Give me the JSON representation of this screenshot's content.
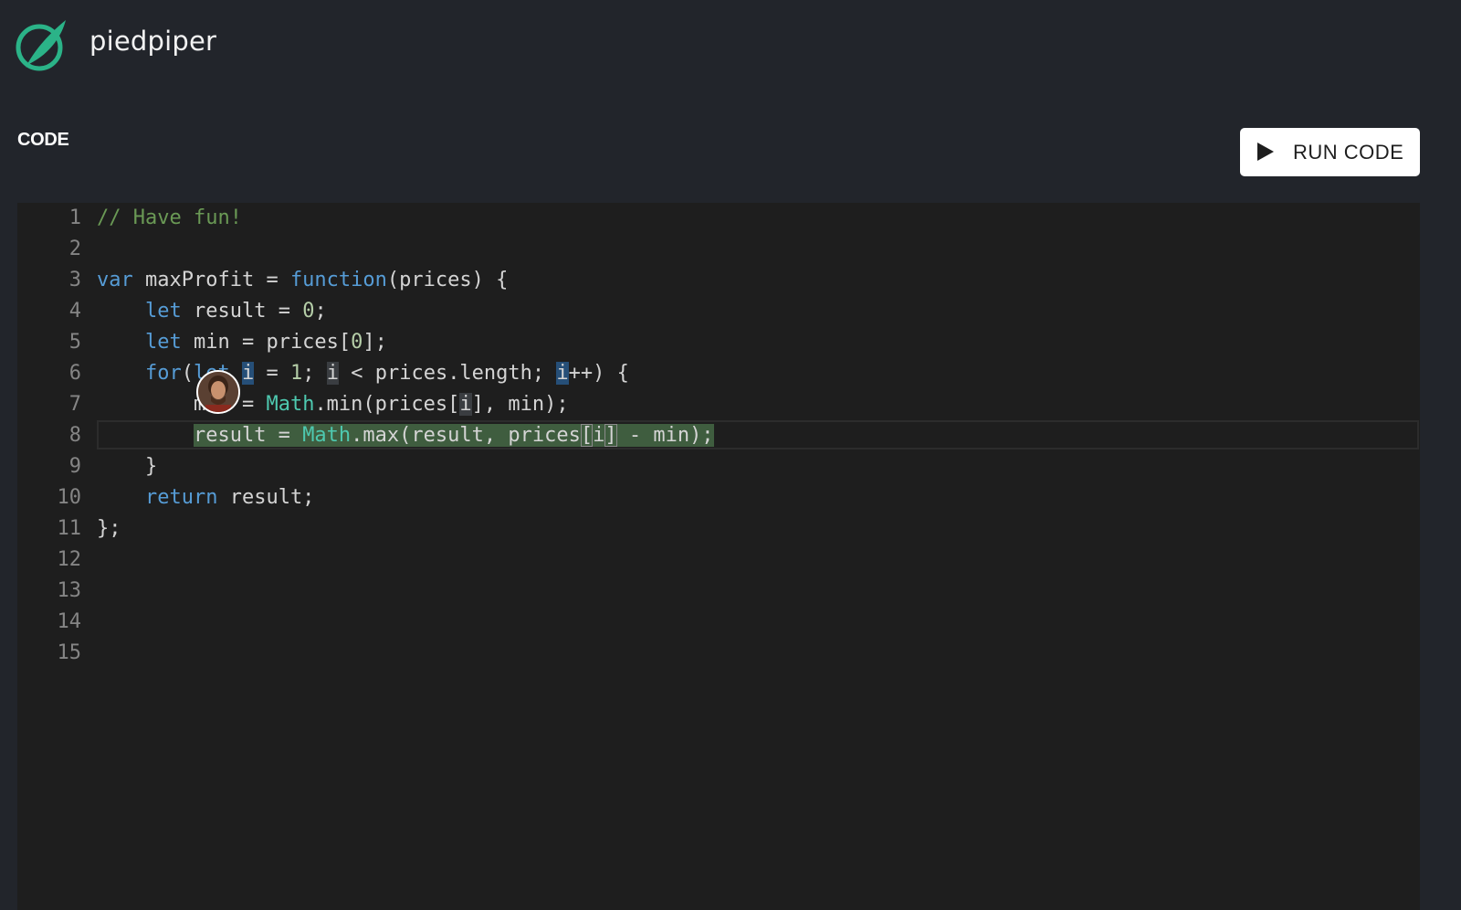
{
  "brand": {
    "name": "piedpiper",
    "logo_icon": "piedpiper-logo-icon",
    "accent": "#2bb388"
  },
  "section": {
    "title": "CODE"
  },
  "toolbar": {
    "run_label": "RUN CODE",
    "run_icon": "play-icon"
  },
  "editor": {
    "line_numbers": [
      "1",
      "2",
      "3",
      "4",
      "5",
      "6",
      "7",
      "8",
      "9",
      "10",
      "11",
      "12",
      "13",
      "14",
      "15"
    ],
    "current_line": 8,
    "collaborator_avatar": "user-avatar"
  },
  "colors": {
    "background": "#22252b",
    "editor_bg": "#1e1e1e",
    "keyword": "#569cd6",
    "type": "#4ec9b0",
    "number": "#b5cea8",
    "comment": "#6a9955",
    "selection": "#3f5d3f"
  },
  "code": {
    "line1": {
      "comment": "// Have fun!"
    },
    "line3": {
      "var": "var",
      "name": " maxProfit = ",
      "function": "function",
      "rest": "(prices) {"
    },
    "line4": {
      "indent": "    ",
      "let": "let",
      "mid": " result = ",
      "zero": "0",
      "end": ";"
    },
    "line5": {
      "indent": "    ",
      "let": "let",
      "mid": " min = prices[",
      "zero": "0",
      "end": "];"
    },
    "line6": {
      "indent": "    ",
      "for": "for",
      "open": "(",
      "let": "let",
      "sp": " ",
      "i1": "i",
      "eq": " = ",
      "one": "1",
      "semi": "; ",
      "i2": "i",
      "cond": " < prices.length; ",
      "i3": "i",
      "end": "++) {"
    },
    "line7": {
      "indent": "        ",
      "lhs": "min = ",
      "math": "Math",
      "call": ".min(prices[",
      "i": "i",
      "end": "], min);"
    },
    "line8": {
      "indent": "        ",
      "lhs": "result = ",
      "math": "Math",
      "call": ".max(result, prices",
      "lb": "[",
      "i": "i",
      "rb": "]",
      "end": " - min);"
    },
    "line9": {
      "text": "    }"
    },
    "line10": {
      "indent": "    ",
      "return": "return",
      "end": " result;"
    },
    "line11": {
      "text": "};"
    }
  }
}
